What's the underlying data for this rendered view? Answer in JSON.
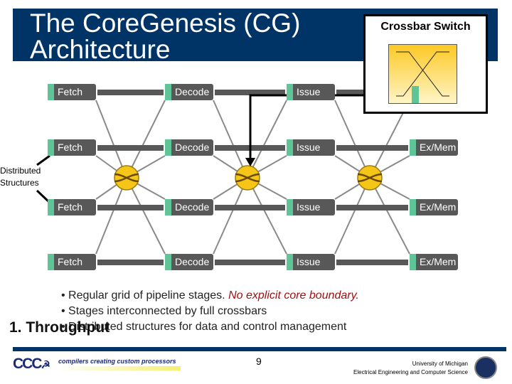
{
  "title": "The CoreGenesis (CG) Architecture",
  "callout": {
    "title": "Crossbar Switch"
  },
  "grid": {
    "columns": [
      "Fetch",
      "Decode",
      "Issue",
      "Ex/Mem"
    ],
    "rows": 4
  },
  "distributed_label_line1": "Distributed",
  "distributed_label_line2": "Structures",
  "bullets": {
    "b1_text": "• Regular grid of pipeline stages. ",
    "b1_emph": "No explicit core boundary.",
    "b2": "• Stages interconnected by full crossbars",
    "b3": "• Distributed structures for data and control management"
  },
  "heading": "1. Throughput",
  "footer": {
    "logo": "CCC",
    "tagline": "compilers creating custom processors",
    "page": "9",
    "uni_line1": "University of Michigan",
    "uni_line2": "Electrical Engineering and Computer Science"
  },
  "colors": {
    "banner": "#003366",
    "stage": "#585858",
    "stage_tab": "#5fc497",
    "crossbar": "#f5c518",
    "emphasis": "#a01010"
  }
}
